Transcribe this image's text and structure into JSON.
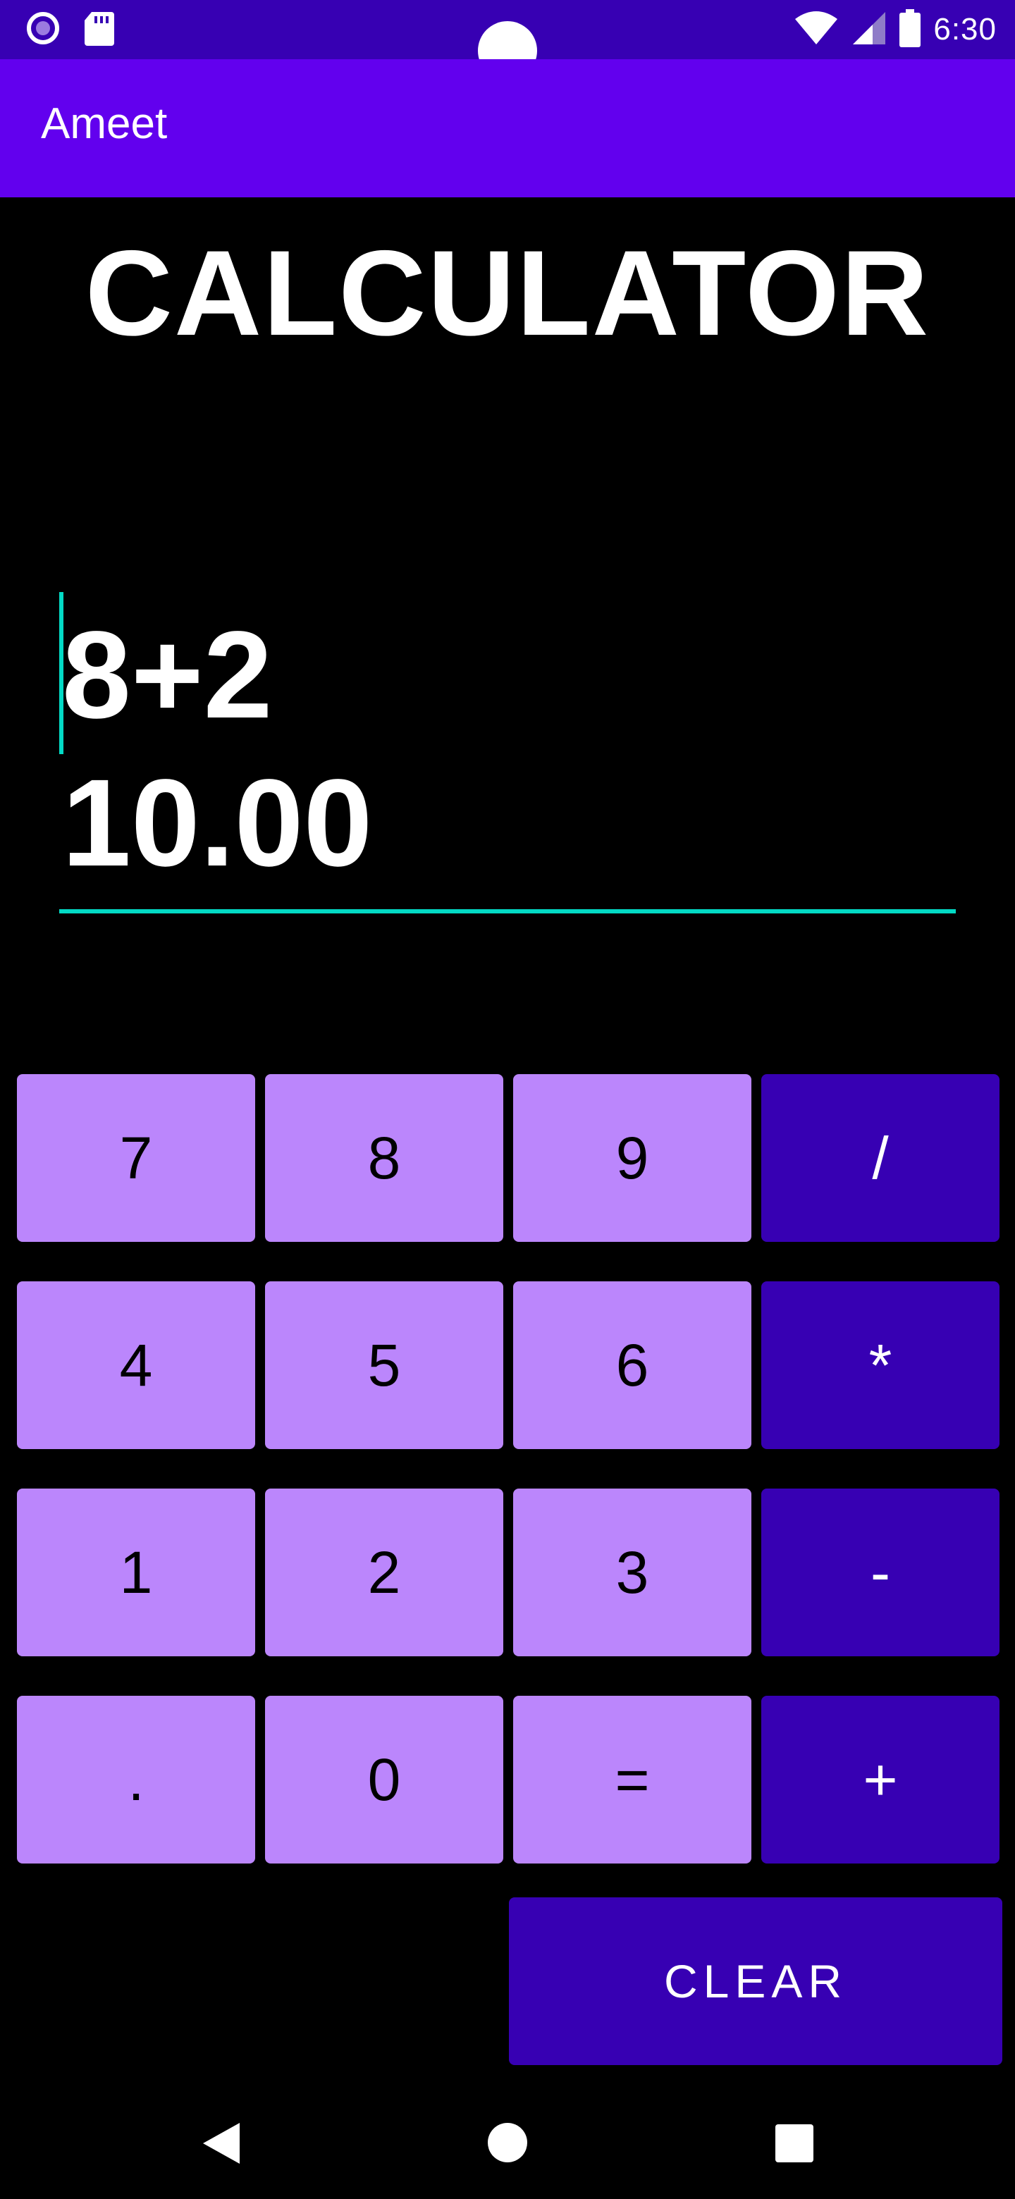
{
  "status_bar": {
    "time": "6:30",
    "icons": [
      "record-icon",
      "sd-card-icon",
      "wifi-icon",
      "signal-icon",
      "battery-icon"
    ],
    "color": "#3700B3"
  },
  "app_bar": {
    "title": "Ameet",
    "color": "#6200EE"
  },
  "heading": "CALCULATOR",
  "display": {
    "expression": "8+2",
    "result": "10.00",
    "accent_color": "#03DAC5"
  },
  "keypad": {
    "number_key_color": "#BB86FC",
    "operator_key_color": "#3700B3",
    "rows": [
      [
        "7",
        "8",
        "9",
        "/"
      ],
      [
        "4",
        "5",
        "6",
        "*"
      ],
      [
        "1",
        "2",
        "3",
        "-"
      ],
      [
        ".",
        "0",
        "=",
        "+"
      ]
    ],
    "clear_label": "CLEAR"
  },
  "nav_bar": {
    "icons": [
      "back-icon",
      "home-icon",
      "recents-icon"
    ]
  }
}
